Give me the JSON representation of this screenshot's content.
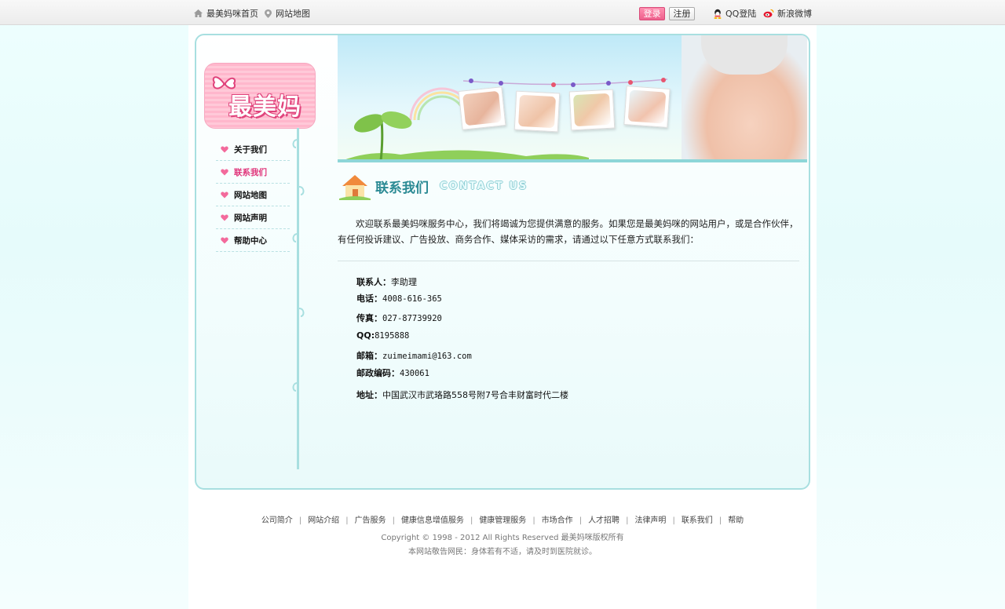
{
  "topbar": {
    "home_link": "最美妈咪首页",
    "sitemap_link": "网站地图",
    "login_label": "登录",
    "register_label": "注册",
    "qq_login": "QQ登陆",
    "weibo_login": "新浪微博"
  },
  "logo": {
    "text": "最美妈咪"
  },
  "menu": {
    "items": [
      {
        "label": "关于我们"
      },
      {
        "label": "联系我们"
      },
      {
        "label": "网站地图"
      },
      {
        "label": "网站声明"
      },
      {
        "label": "帮助中心"
      }
    ]
  },
  "section": {
    "title": "联系我们",
    "title_en": "CONTACT US",
    "intro": "欢迎联系最美妈咪服务中心，我们将竭诚为您提供满意的服务。如果您是最美妈咪的网站用户，或是合作伙伴，有任何投诉建议、广告投放、商务合作、媒体采访的需求，请通过以下任意方式联系我们："
  },
  "contact": {
    "person_label": "联系人：",
    "person": "李助理",
    "phone_label": "电话：",
    "phone": "4008-616-365",
    "fax_label": "传真：",
    "fax": "027-87739920",
    "qq_label": "QQ:",
    "qq": "8195888",
    "email_label": "邮箱：",
    "email": "zuimeimami@163.com",
    "zip_label": "邮政编码：",
    "zip": "430061",
    "address_label": "地址：",
    "address": "中国武汉市武珞路558号附7号合丰财富时代二楼"
  },
  "footer": {
    "links": [
      "公司简介",
      "网站介绍",
      "广告服务",
      "健康信息增值服务",
      "健康管理服务",
      "市场合作",
      "人才招聘",
      "法律声明",
      "联系我们",
      "帮助"
    ],
    "copyright": "Copyright © 1998 - 2012  All Rights Reserved 最美妈咪版权所有",
    "warning": "本网站敬告网民：身体若有不适，请及时到医院就诊。"
  },
  "colors": {
    "accent": "#2b8a94",
    "pink": "#e0347a",
    "frame": "#a8dfe0"
  }
}
